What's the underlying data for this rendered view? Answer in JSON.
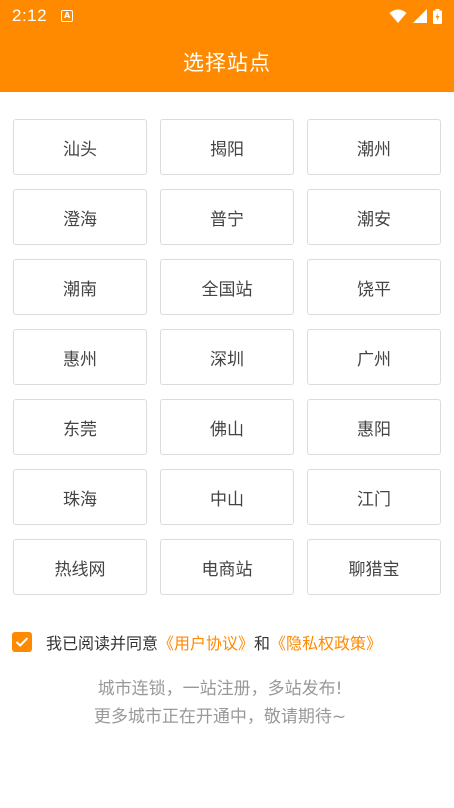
{
  "status_bar": {
    "time": "2:12",
    "notification_icon": "a-letter-icon",
    "icons": [
      "wifi-icon",
      "signal-icon",
      "battery-icon"
    ]
  },
  "app_bar": {
    "title": "选择站点"
  },
  "sites": [
    {
      "label": "汕头"
    },
    {
      "label": "揭阳"
    },
    {
      "label": "潮州"
    },
    {
      "label": "澄海"
    },
    {
      "label": "普宁"
    },
    {
      "label": "潮安"
    },
    {
      "label": "潮南"
    },
    {
      "label": "全国站"
    },
    {
      "label": "饶平"
    },
    {
      "label": "惠州"
    },
    {
      "label": "深圳"
    },
    {
      "label": "广州"
    },
    {
      "label": "东莞"
    },
    {
      "label": "佛山"
    },
    {
      "label": "惠阳"
    },
    {
      "label": "珠海"
    },
    {
      "label": "中山"
    },
    {
      "label": "江门"
    },
    {
      "label": "热线网"
    },
    {
      "label": "电商站"
    },
    {
      "label": "聊猎宝"
    }
  ],
  "agreement": {
    "checked": true,
    "prefix": "我已阅读并同意",
    "user_agreement": "《用户协议》",
    "conjunction": "和",
    "privacy_policy": "《隐私权政策》"
  },
  "footer": {
    "line1": "城市连锁，一站注册，多站发布!",
    "line2": "更多城市正在开通中，敬请期待~"
  },
  "colors": {
    "accent": "#FF8A00",
    "border": "#dcdcdc",
    "text": "#444444",
    "muted": "#999999"
  }
}
